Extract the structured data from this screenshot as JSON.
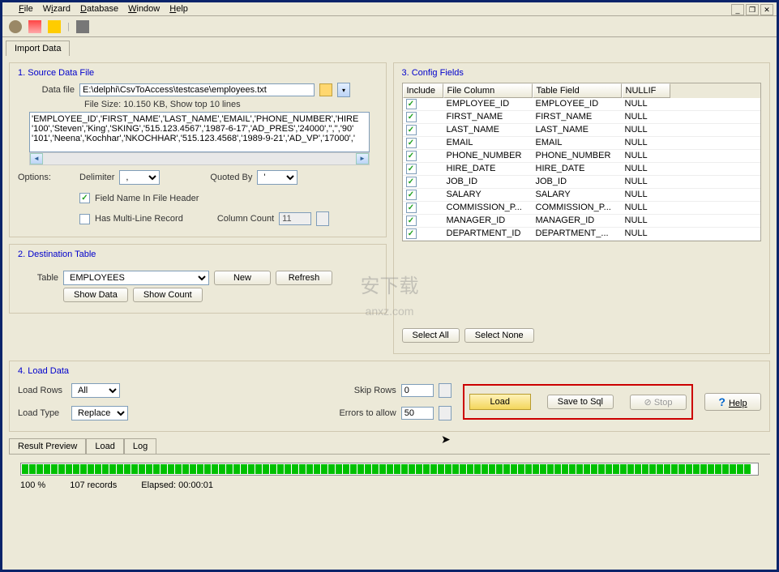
{
  "menu": {
    "file": "File",
    "wizard": "Wizard",
    "database": "Database",
    "window": "Window",
    "help": "Help"
  },
  "tabs": {
    "import": "Import Data"
  },
  "source": {
    "title": "1. Source Data File",
    "datafile_label": "Data file",
    "datafile": "E:\\delphi\\CsvToAccess\\testcase\\employees.txt",
    "filesize": "File Size: 10.150 KB,  Show top 10 lines",
    "preview_l1": "'EMPLOYEE_ID','FIRST_NAME','LAST_NAME','EMAIL','PHONE_NUMBER','HIRE",
    "preview_l2": "'100','Steven','King','SKING','515.123.4567','1987-6-17','AD_PRES','24000','','','90'",
    "preview_l3": "'101','Neena','Kochhar','NKOCHHAR','515.123.4568','1989-9-21','AD_VP','17000','",
    "options": "Options:",
    "delimiter_lbl": "Delimiter",
    "delimiter": ",",
    "quoted_lbl": "Quoted By",
    "quoted": "'",
    "field_header": "Field Name In File Header",
    "multiline": "Has Multi-Line Record",
    "colcount_lbl": "Column Count",
    "colcount": "11"
  },
  "dest": {
    "title": "2. Destination Table",
    "table_lbl": "Table",
    "table": "EMPLOYEES",
    "new": "New",
    "refresh": "Refresh",
    "showdata": "Show Data",
    "showcount": "Show Count"
  },
  "config": {
    "title": "3. Config Fields",
    "hdr": {
      "inc": "Include",
      "fc": "File Column",
      "tf": "Table Field",
      "nl": "NULLIF"
    },
    "rows": [
      {
        "fc": "EMPLOYEE_ID",
        "tf": "EMPLOYEE_ID",
        "nl": "NULL"
      },
      {
        "fc": "FIRST_NAME",
        "tf": "FIRST_NAME",
        "nl": "NULL"
      },
      {
        "fc": "LAST_NAME",
        "tf": "LAST_NAME",
        "nl": "NULL"
      },
      {
        "fc": "EMAIL",
        "tf": "EMAIL",
        "nl": "NULL"
      },
      {
        "fc": "PHONE_NUMBER",
        "tf": "PHONE_NUMBER",
        "nl": "NULL"
      },
      {
        "fc": "HIRE_DATE",
        "tf": "HIRE_DATE",
        "nl": "NULL"
      },
      {
        "fc": "JOB_ID",
        "tf": "JOB_ID",
        "nl": "NULL"
      },
      {
        "fc": "SALARY",
        "tf": "SALARY",
        "nl": "NULL"
      },
      {
        "fc": "COMMISSION_P...",
        "tf": "COMMISSION_P...",
        "nl": "NULL"
      },
      {
        "fc": "MANAGER_ID",
        "tf": "MANAGER_ID",
        "nl": "NULL"
      },
      {
        "fc": "DEPARTMENT_ID",
        "tf": "DEPARTMENT_...",
        "nl": "NULL"
      }
    ],
    "selectall": "Select All",
    "selectnone": "Select None"
  },
  "load": {
    "title": "4. Load Data",
    "loadrows_lbl": "Load Rows",
    "loadrows": "All",
    "loadtype_lbl": "Load Type",
    "loadtype": "Replace",
    "skip_lbl": "Skip Rows",
    "skip": "0",
    "errors_lbl": "Errors to allow",
    "errors": "50",
    "load_btn": "Load",
    "save_btn": "Save to Sql",
    "stop_btn": "Stop",
    "help_btn": "Help"
  },
  "btabs": {
    "rp": "Result Preview",
    "load": "Load",
    "log": "Log"
  },
  "progress": {
    "pct": "100 %",
    "records": "107 records",
    "elapsed": "Elapsed:  00:00:01"
  },
  "watermark": "安下载\nanxz.com"
}
